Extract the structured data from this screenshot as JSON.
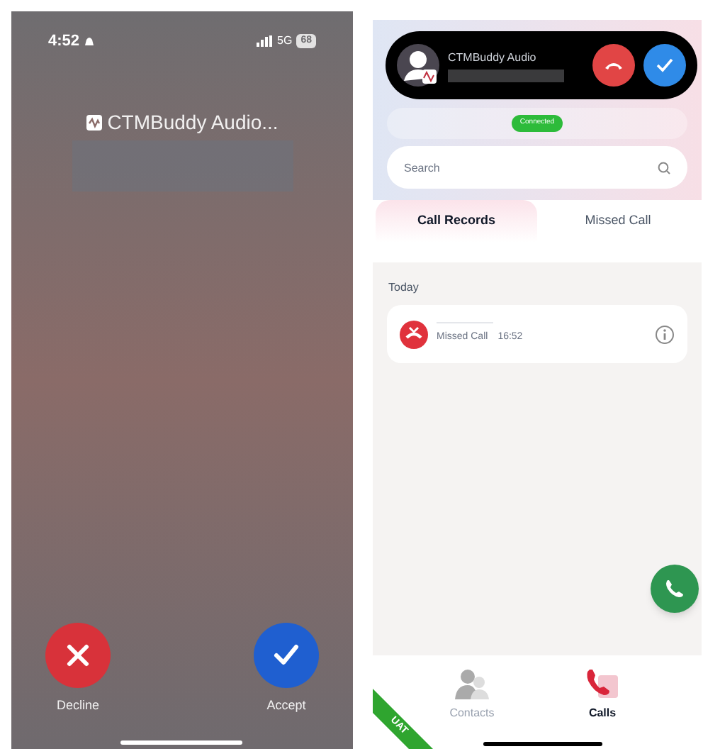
{
  "incoming_call_screen": {
    "status_bar": {
      "time": "4:52",
      "network": "5G",
      "battery": "68"
    },
    "caller": "CTMBuddy Audio...",
    "actions": [
      {
        "label": "Decline",
        "kind": "decline"
      },
      {
        "label": "Accept",
        "kind": "accept"
      }
    ]
  },
  "app_screen": {
    "call_banner": {
      "title": "CTMBuddy Audio"
    },
    "connection_badge": "Connected",
    "search": {
      "placeholder": "Search"
    },
    "tabs": [
      {
        "label": "Call Records",
        "selected": true
      },
      {
        "label": "Missed Call",
        "selected": false
      }
    ],
    "section": "Today",
    "records": [
      {
        "status": "Missed Call",
        "time": "16:52"
      }
    ],
    "nav": [
      {
        "label": "Contacts",
        "kind": "contacts",
        "selected": false
      },
      {
        "label": "Calls",
        "kind": "calls",
        "selected": true
      }
    ],
    "ribbon": "UAT"
  }
}
